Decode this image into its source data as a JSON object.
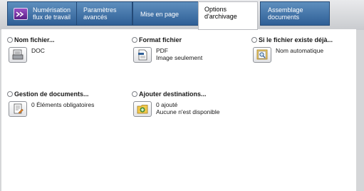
{
  "tabs": [
    {
      "label_line1": "Numérisation",
      "label_line2": "flux de travail",
      "active": false,
      "icon": "workflow-scan-icon"
    },
    {
      "label_line1": "Paramètres",
      "label_line2": "avancés",
      "active": false
    },
    {
      "label_line1": "Mise en page",
      "active": false
    },
    {
      "label_line1": "Options",
      "label_line2": "d'archivage",
      "active": true
    },
    {
      "label_line1": "Assemblage",
      "label_line2": "documents",
      "active": false
    }
  ],
  "options": {
    "file_name": {
      "title": "Nom fichier...",
      "value": "DOC",
      "icon": "file-name-icon"
    },
    "file_format": {
      "title": "Format fichier",
      "value_line1": "PDF",
      "value_line2": "Image seulement",
      "icon": "file-format-icon"
    },
    "file_exists": {
      "title": "Si le fichier existe déjà...",
      "value": "Nom automatique",
      "icon": "file-exists-icon"
    },
    "document_management": {
      "title": "Gestion de documents...",
      "value": "0 Éléments obligatoires",
      "icon": "document-management-icon"
    },
    "add_destinations": {
      "title": "Ajouter destinations...",
      "value_line1": "0 ajouté",
      "value_line2": "Aucune n'est disponible",
      "icon": "add-destinations-icon"
    }
  }
}
